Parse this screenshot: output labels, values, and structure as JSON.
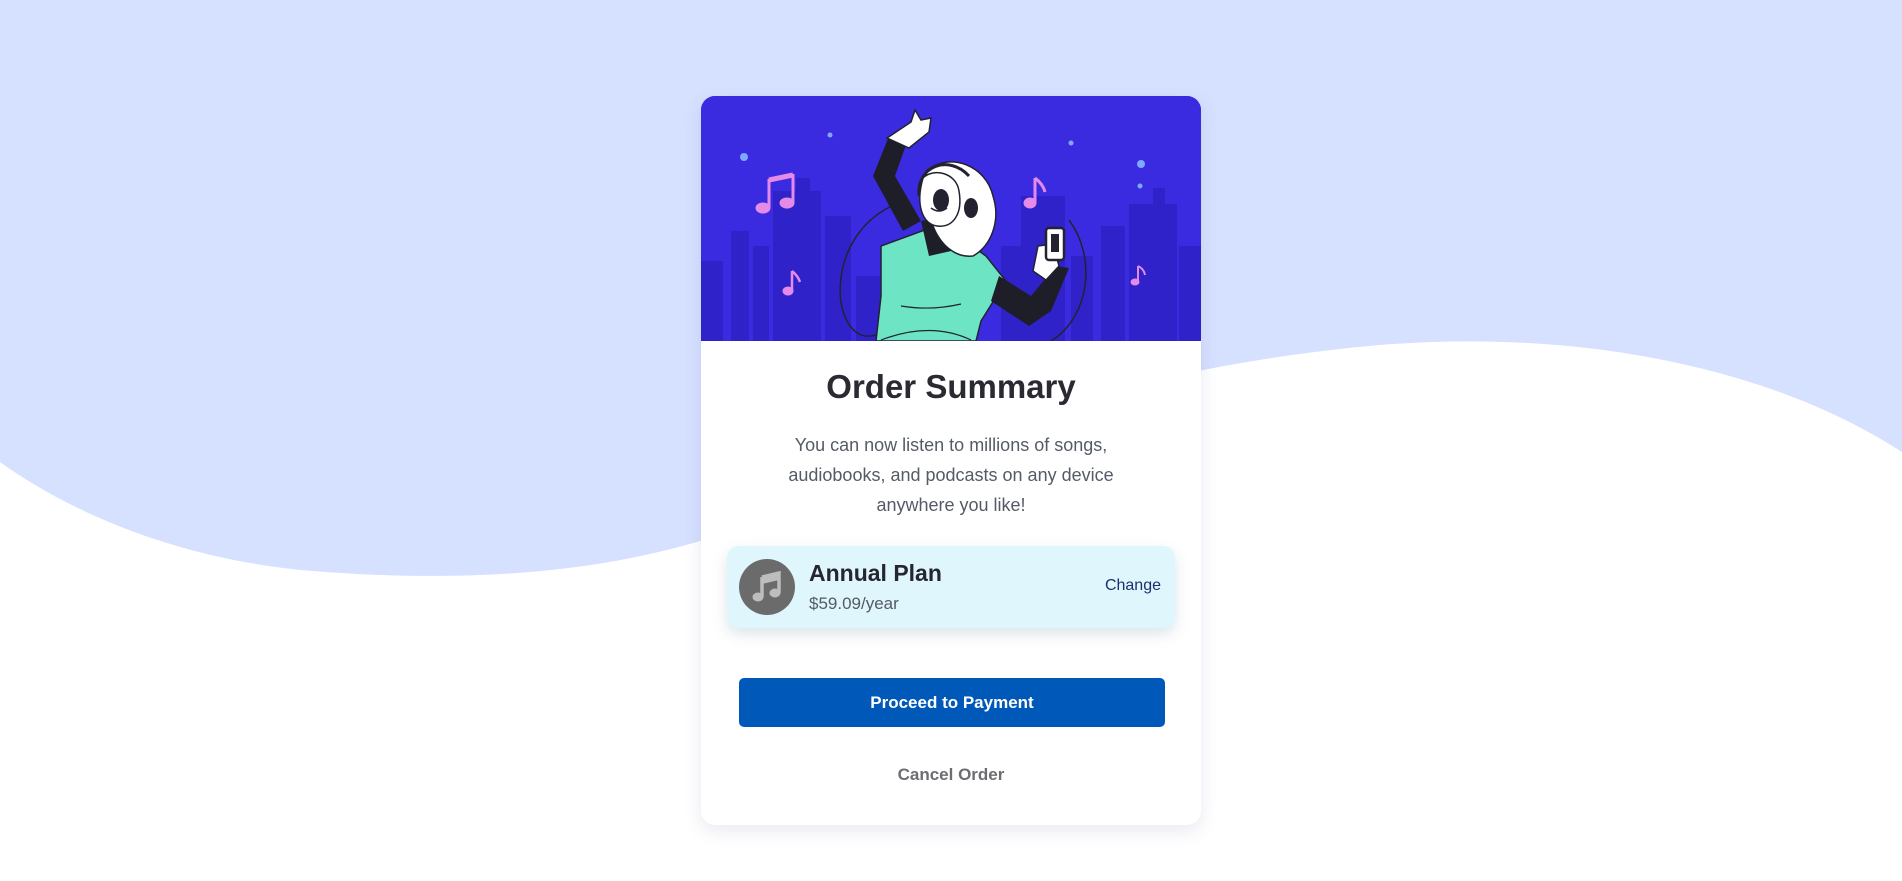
{
  "colors": {
    "page_background_top": "#d6e0ff",
    "page_background_bottom": "#ffffff",
    "hero_background": "#3b2be0",
    "plan_background": "#dff6fc",
    "primary_button": "#0058b8",
    "plan_icon_background": "#6b6b6b"
  },
  "hero": {
    "illustration": "person-dancing-with-headphones-and-phone-city-night"
  },
  "summary": {
    "title": "Order Summary",
    "description": "You can now listen to millions of songs, audiobooks, and podcasts on any device anywhere you like!"
  },
  "plan": {
    "icon": "music-note-icon",
    "name": "Annual Plan",
    "price": "$59.09/year",
    "change_label": "Change"
  },
  "actions": {
    "proceed_label": "Proceed to Payment",
    "cancel_label": "Cancel Order"
  }
}
